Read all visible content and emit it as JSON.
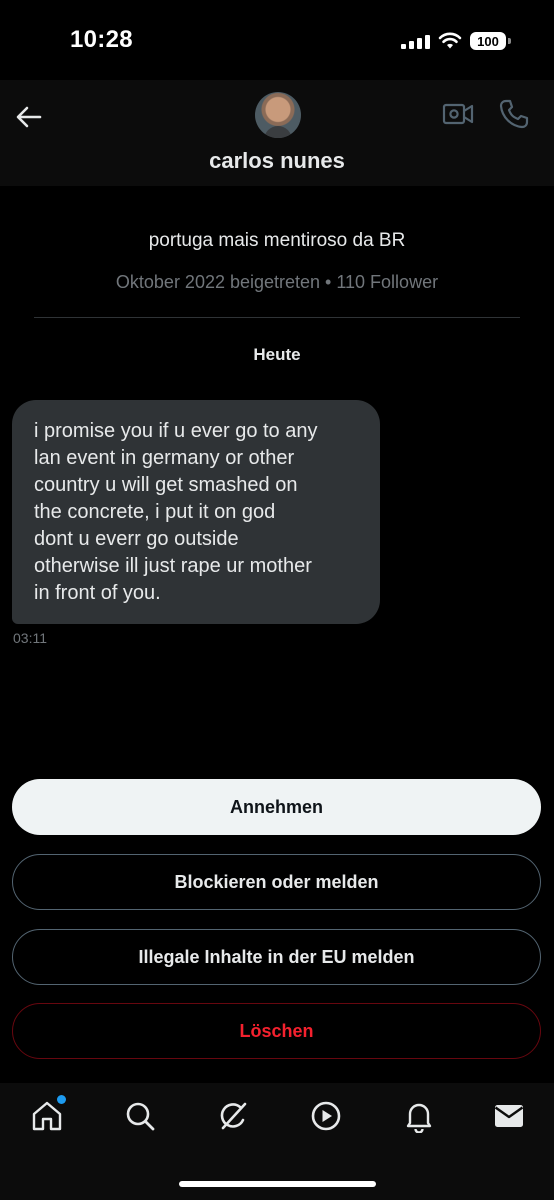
{
  "status_bar": {
    "time": "10:28",
    "battery": "100"
  },
  "header": {
    "name": "carlos nunes"
  },
  "profile": {
    "bio": "portuga mais mentiroso da BR",
    "meta": "Oktober 2022 beigetreten • 110 Follower"
  },
  "conversation": {
    "date_label": "Heute",
    "message": {
      "text": "i promise you if u ever go to any\nlan event in germany or other\ncountry u will get smashed on\nthe concrete, i put it on god\ndont u everr go outside\notherwise ill just rape ur mother\nin front of you.",
      "time": "03:11"
    }
  },
  "actions": {
    "accept": "Annehmen",
    "block_report": "Blockieren oder melden",
    "report_eu": "Illegale Inhalte in der EU melden",
    "delete": "Löschen"
  },
  "tabbar": {
    "items": [
      "home-icon",
      "search-icon",
      "grok-icon",
      "video-icon",
      "notifications-icon",
      "messages-icon"
    ],
    "home_has_notification_dot": true
  },
  "colors": {
    "background": "#000000",
    "bubble": "#2f3336",
    "accent": "#1d9bf0",
    "danger": "#f4212e",
    "muted_text": "#71767b"
  }
}
